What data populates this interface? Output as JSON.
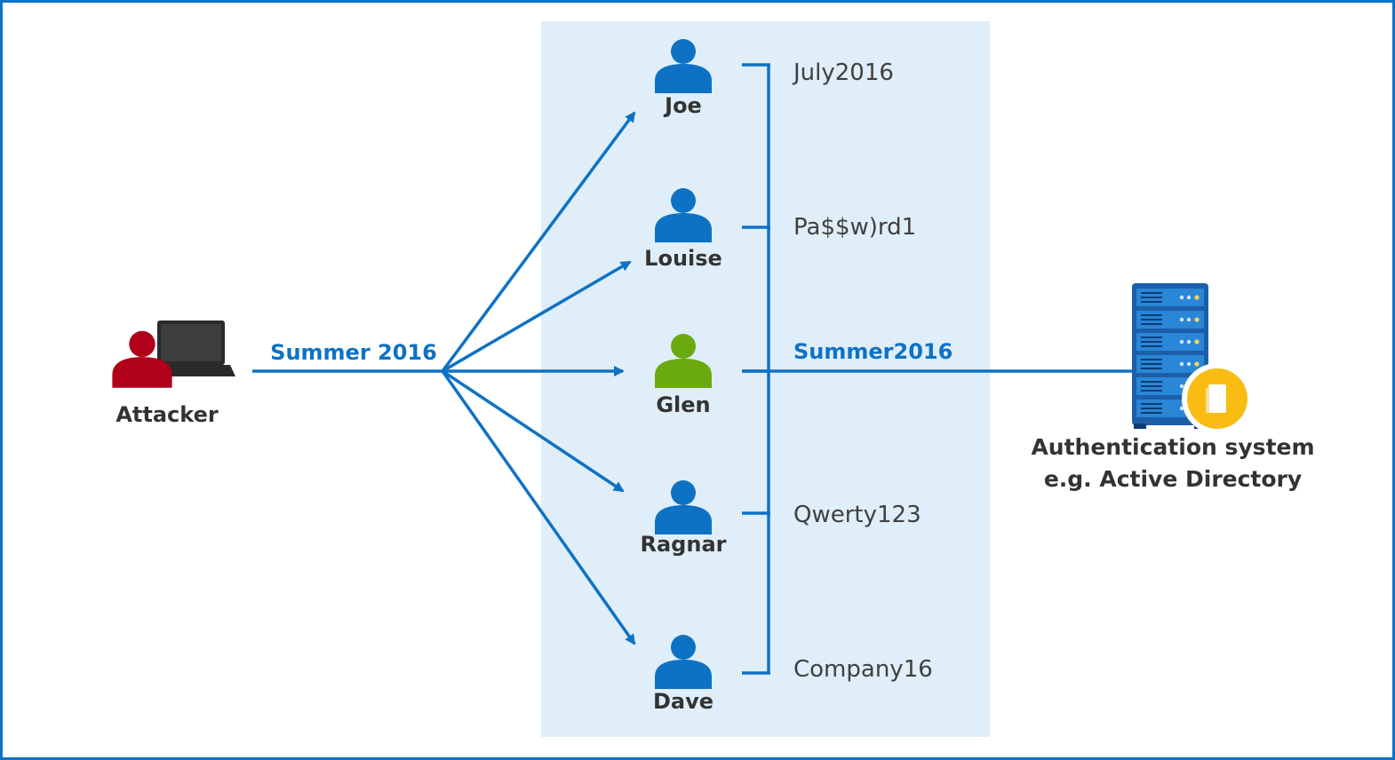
{
  "colors": {
    "accent": "#0e72c4",
    "panel": "#dfeef8",
    "user_default": "#0e72c4",
    "user_compromised": "#6aaa0e",
    "attacker": "#b0001a",
    "laptop": "#2a2a2a",
    "server": "#1c5fa8",
    "badge": "#f8bc12"
  },
  "attacker": {
    "label": "Attacker",
    "icon": "attacker-laptop-icon"
  },
  "spray_password": "Summer 2016",
  "users": [
    {
      "name": "Joe",
      "password": "July2016",
      "compromised": false
    },
    {
      "name": "Louise",
      "password": "Pa$$w)rd1",
      "compromised": false
    },
    {
      "name": "Glen",
      "password": "Summer2016",
      "compromised": true
    },
    {
      "name": "Ragnar",
      "password": "Qwerty123",
      "compromised": false
    },
    {
      "name": "Dave",
      "password": "Company16",
      "compromised": false
    }
  ],
  "auth_system": {
    "line1": "Authentication system",
    "line2": "e.g. Active Directory",
    "icon": "server-icon"
  }
}
